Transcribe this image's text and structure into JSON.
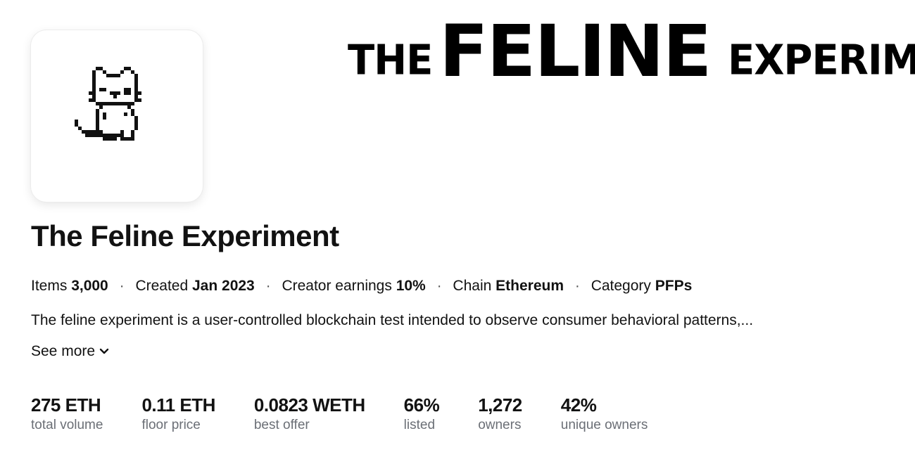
{
  "banner": {
    "word1": "THE",
    "word2": "FELINE",
    "word3": "EXPERIMENT"
  },
  "avatar": {
    "icon": "pixel-cat-icon"
  },
  "collection": {
    "title": "The Feline Experiment"
  },
  "meta": {
    "items_label": "Items",
    "items_value": "3,000",
    "created_label": "Created",
    "created_value": "Jan 2023",
    "earnings_label": "Creator earnings",
    "earnings_value": "10%",
    "chain_label": "Chain",
    "chain_value": "Ethereum",
    "category_label": "Category",
    "category_value": "PFPs",
    "separator": "·"
  },
  "description": "The feline experiment is a user-controlled blockchain test intended to observe consumer behavioral patterns,...",
  "see_more": {
    "label": "See more",
    "icon": "chevron-down-icon"
  },
  "stats": [
    {
      "value": "275 ETH",
      "label": "total volume"
    },
    {
      "value": "0.11 ETH",
      "label": "floor price"
    },
    {
      "value": "0.0823 WETH",
      "label": "best offer"
    },
    {
      "value": "66%",
      "label": "listed"
    },
    {
      "value": "1,272",
      "label": "owners"
    },
    {
      "value": "42%",
      "label": "unique owners"
    }
  ],
  "colors": {
    "text": "#121212",
    "muted": "#6b6f76",
    "background": "#ffffff"
  }
}
